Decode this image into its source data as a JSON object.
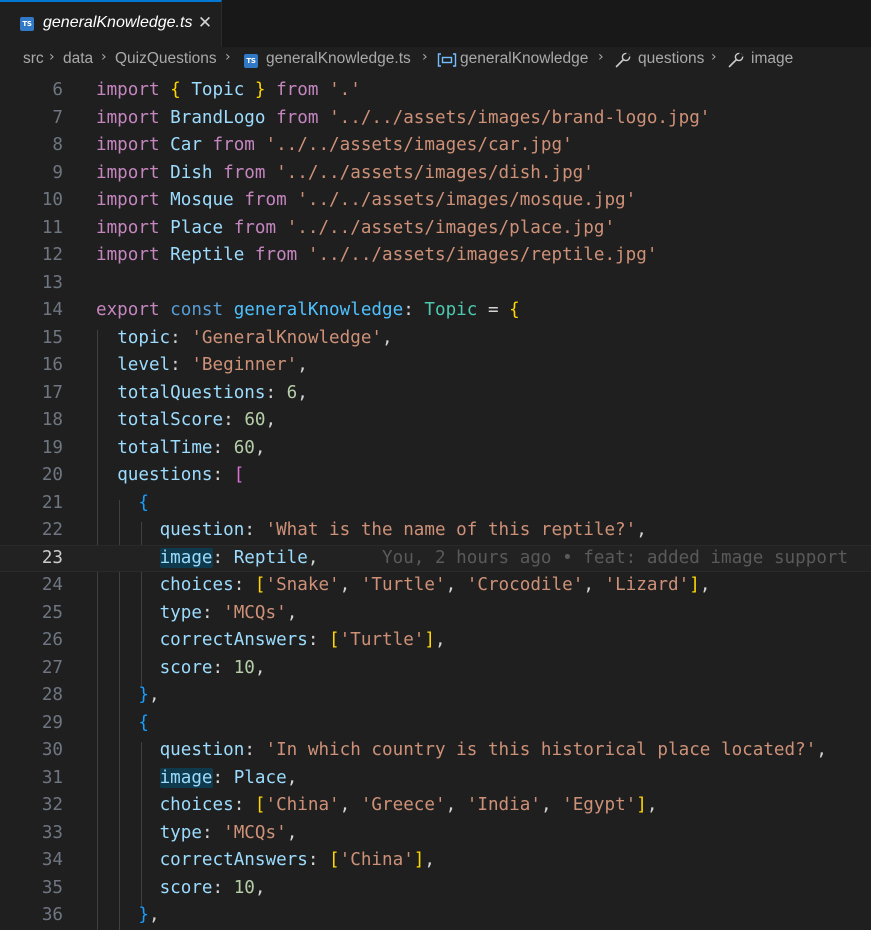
{
  "tab": {
    "filename": "generalKnowledge.ts",
    "close": "✕",
    "icon": "typescript-file-icon",
    "icon_text": "TS"
  },
  "breadcrumb": {
    "separator": "›",
    "items": [
      {
        "label": "src",
        "icon": ""
      },
      {
        "label": "data",
        "icon": ""
      },
      {
        "label": "QuizQuestions",
        "icon": ""
      },
      {
        "label": "generalKnowledge.ts",
        "icon": "typescript-file-icon"
      },
      {
        "label": "generalKnowledge",
        "icon": "variable-icon"
      },
      {
        "label": "questions",
        "icon": "wrench-icon"
      },
      {
        "label": "image",
        "icon": "wrench-icon"
      }
    ]
  },
  "editor": {
    "current_line": 23,
    "colors": {
      "keyword": "#c586c0",
      "string": "#ce9178",
      "property": "#9cdcfe",
      "type": "#4ec9b0",
      "number": "#b5cea8",
      "storage": "#569cd6",
      "const": "#4fc1ff",
      "bracket1": "#ffd700",
      "bracket2": "#da70d6",
      "bracket3": "#179fff"
    },
    "lines": [
      {
        "num": "6",
        "tokens": [
          [
            "k",
            "import"
          ],
          [
            "p",
            " "
          ],
          [
            "b1",
            "{"
          ],
          [
            "p",
            " "
          ],
          [
            "v",
            "Topic"
          ],
          [
            "p",
            " "
          ],
          [
            "b1",
            "}"
          ],
          [
            "p",
            " "
          ],
          [
            "k",
            "from"
          ],
          [
            "p",
            " "
          ],
          [
            "s",
            "'.'"
          ]
        ]
      },
      {
        "num": "7",
        "tokens": [
          [
            "k",
            "import"
          ],
          [
            "p",
            " "
          ],
          [
            "v",
            "BrandLogo"
          ],
          [
            "p",
            " "
          ],
          [
            "k",
            "from"
          ],
          [
            "p",
            " "
          ],
          [
            "s",
            "'../../assets/images/brand-logo.jpg'"
          ]
        ]
      },
      {
        "num": "8",
        "tokens": [
          [
            "k",
            "import"
          ],
          [
            "p",
            " "
          ],
          [
            "v",
            "Car"
          ],
          [
            "p",
            " "
          ],
          [
            "k",
            "from"
          ],
          [
            "p",
            " "
          ],
          [
            "s",
            "'../../assets/images/car.jpg'"
          ]
        ]
      },
      {
        "num": "9",
        "tokens": [
          [
            "k",
            "import"
          ],
          [
            "p",
            " "
          ],
          [
            "v",
            "Dish"
          ],
          [
            "p",
            " "
          ],
          [
            "k",
            "from"
          ],
          [
            "p",
            " "
          ],
          [
            "s",
            "'../../assets/images/dish.jpg'"
          ]
        ]
      },
      {
        "num": "10",
        "tokens": [
          [
            "k",
            "import"
          ],
          [
            "p",
            " "
          ],
          [
            "v",
            "Mosque"
          ],
          [
            "p",
            " "
          ],
          [
            "k",
            "from"
          ],
          [
            "p",
            " "
          ],
          [
            "s",
            "'../../assets/images/mosque.jpg'"
          ]
        ]
      },
      {
        "num": "11",
        "tokens": [
          [
            "k",
            "import"
          ],
          [
            "p",
            " "
          ],
          [
            "v",
            "Place"
          ],
          [
            "p",
            " "
          ],
          [
            "k",
            "from"
          ],
          [
            "p",
            " "
          ],
          [
            "s",
            "'../../assets/images/place.jpg'"
          ]
        ]
      },
      {
        "num": "12",
        "tokens": [
          [
            "k",
            "import"
          ],
          [
            "p",
            " "
          ],
          [
            "v",
            "Reptile"
          ],
          [
            "p",
            " "
          ],
          [
            "k",
            "from"
          ],
          [
            "p",
            " "
          ],
          [
            "s",
            "'../../assets/images/reptile.jpg'"
          ]
        ]
      },
      {
        "num": "13",
        "tokens": []
      },
      {
        "num": "14",
        "tokens": [
          [
            "k",
            "export"
          ],
          [
            "p",
            " "
          ],
          [
            "c",
            "const"
          ],
          [
            "p",
            " "
          ],
          [
            "cn",
            "generalKnowledge"
          ],
          [
            "p",
            ": "
          ],
          [
            "t",
            "Topic"
          ],
          [
            "p",
            " = "
          ],
          [
            "b1",
            "{"
          ]
        ]
      },
      {
        "num": "15",
        "tokens": [
          [
            "p",
            "  "
          ],
          [
            "v",
            "topic"
          ],
          [
            "p",
            ": "
          ],
          [
            "s",
            "'GeneralKnowledge'"
          ],
          [
            "p",
            ","
          ]
        ]
      },
      {
        "num": "16",
        "tokens": [
          [
            "p",
            "  "
          ],
          [
            "v",
            "level"
          ],
          [
            "p",
            ": "
          ],
          [
            "s",
            "'Beginner'"
          ],
          [
            "p",
            ","
          ]
        ]
      },
      {
        "num": "17",
        "tokens": [
          [
            "p",
            "  "
          ],
          [
            "v",
            "totalQuestions"
          ],
          [
            "p",
            ": "
          ],
          [
            "n",
            "6"
          ],
          [
            "p",
            ","
          ]
        ]
      },
      {
        "num": "18",
        "tokens": [
          [
            "p",
            "  "
          ],
          [
            "v",
            "totalScore"
          ],
          [
            "p",
            ": "
          ],
          [
            "n",
            "60"
          ],
          [
            "p",
            ","
          ]
        ]
      },
      {
        "num": "19",
        "tokens": [
          [
            "p",
            "  "
          ],
          [
            "v",
            "totalTime"
          ],
          [
            "p",
            ": "
          ],
          [
            "n",
            "60"
          ],
          [
            "p",
            ","
          ]
        ]
      },
      {
        "num": "20",
        "tokens": [
          [
            "p",
            "  "
          ],
          [
            "v",
            "questions"
          ],
          [
            "p",
            ": "
          ],
          [
            "b2",
            "["
          ]
        ]
      },
      {
        "num": "21",
        "tokens": [
          [
            "p",
            "    "
          ],
          [
            "b3",
            "{"
          ]
        ]
      },
      {
        "num": "22",
        "tokens": [
          [
            "p",
            "      "
          ],
          [
            "v",
            "question"
          ],
          [
            "p",
            ": "
          ],
          [
            "s",
            "'What is the name of this reptile?'"
          ],
          [
            "p",
            ","
          ]
        ]
      },
      {
        "num": "23",
        "tokens": [
          [
            "p",
            "      "
          ],
          [
            "vh",
            "image"
          ],
          [
            "p",
            ": "
          ],
          [
            "v",
            "Reptile"
          ],
          [
            "p",
            ","
          ],
          [
            "p",
            "      "
          ],
          [
            "blame",
            "You, 2 hours ago • feat: added image support"
          ]
        ]
      },
      {
        "num": "24",
        "tokens": [
          [
            "p",
            "      "
          ],
          [
            "v",
            "choices"
          ],
          [
            "p",
            ": "
          ],
          [
            "b1",
            "["
          ],
          [
            "s",
            "'Snake'"
          ],
          [
            "p",
            ", "
          ],
          [
            "s",
            "'Turtle'"
          ],
          [
            "p",
            ", "
          ],
          [
            "s",
            "'Crocodile'"
          ],
          [
            "p",
            ", "
          ],
          [
            "s",
            "'Lizard'"
          ],
          [
            "b1",
            "]"
          ],
          [
            "p",
            ","
          ]
        ]
      },
      {
        "num": "25",
        "tokens": [
          [
            "p",
            "      "
          ],
          [
            "v",
            "type"
          ],
          [
            "p",
            ": "
          ],
          [
            "s",
            "'MCQs'"
          ],
          [
            "p",
            ","
          ]
        ]
      },
      {
        "num": "26",
        "tokens": [
          [
            "p",
            "      "
          ],
          [
            "v",
            "correctAnswers"
          ],
          [
            "p",
            ": "
          ],
          [
            "b1",
            "["
          ],
          [
            "s",
            "'Turtle'"
          ],
          [
            "b1",
            "]"
          ],
          [
            "p",
            ","
          ]
        ]
      },
      {
        "num": "27",
        "tokens": [
          [
            "p",
            "      "
          ],
          [
            "v",
            "score"
          ],
          [
            "p",
            ": "
          ],
          [
            "n",
            "10"
          ],
          [
            "p",
            ","
          ]
        ]
      },
      {
        "num": "28",
        "tokens": [
          [
            "p",
            "    "
          ],
          [
            "b3",
            "}"
          ],
          [
            "p",
            ","
          ]
        ]
      },
      {
        "num": "29",
        "tokens": [
          [
            "p",
            "    "
          ],
          [
            "b3",
            "{"
          ]
        ]
      },
      {
        "num": "30",
        "tokens": [
          [
            "p",
            "      "
          ],
          [
            "v",
            "question"
          ],
          [
            "p",
            ": "
          ],
          [
            "s",
            "'In which country is this historical place located?'"
          ],
          [
            "p",
            ","
          ]
        ]
      },
      {
        "num": "31",
        "tokens": [
          [
            "p",
            "      "
          ],
          [
            "vh",
            "image"
          ],
          [
            "p",
            ": "
          ],
          [
            "v",
            "Place"
          ],
          [
            "p",
            ","
          ]
        ]
      },
      {
        "num": "32",
        "tokens": [
          [
            "p",
            "      "
          ],
          [
            "v",
            "choices"
          ],
          [
            "p",
            ": "
          ],
          [
            "b1",
            "["
          ],
          [
            "s",
            "'China'"
          ],
          [
            "p",
            ", "
          ],
          [
            "s",
            "'Greece'"
          ],
          [
            "p",
            ", "
          ],
          [
            "s",
            "'India'"
          ],
          [
            "p",
            ", "
          ],
          [
            "s",
            "'Egypt'"
          ],
          [
            "b1",
            "]"
          ],
          [
            "p",
            ","
          ]
        ]
      },
      {
        "num": "33",
        "tokens": [
          [
            "p",
            "      "
          ],
          [
            "v",
            "type"
          ],
          [
            "p",
            ": "
          ],
          [
            "s",
            "'MCQs'"
          ],
          [
            "p",
            ","
          ]
        ]
      },
      {
        "num": "34",
        "tokens": [
          [
            "p",
            "      "
          ],
          [
            "v",
            "correctAnswers"
          ],
          [
            "p",
            ": "
          ],
          [
            "b1",
            "["
          ],
          [
            "s",
            "'China'"
          ],
          [
            "b1",
            "]"
          ],
          [
            "p",
            ","
          ]
        ]
      },
      {
        "num": "35",
        "tokens": [
          [
            "p",
            "      "
          ],
          [
            "v",
            "score"
          ],
          [
            "p",
            ": "
          ],
          [
            "n",
            "10"
          ],
          [
            "p",
            ","
          ]
        ]
      },
      {
        "num": "36",
        "tokens": [
          [
            "p",
            "    "
          ],
          [
            "b3",
            "}"
          ],
          [
            "p",
            ","
          ]
        ]
      }
    ]
  }
}
